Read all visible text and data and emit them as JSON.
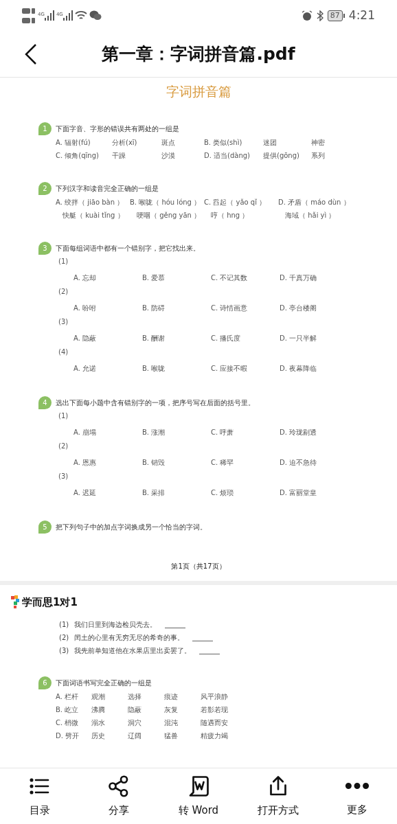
{
  "status_bar": {
    "network_1": "4G",
    "network_2": "4G",
    "battery": "87",
    "time": "4:21"
  },
  "title_bar": {
    "title": "第一章：字词拼音篇.pdf"
  },
  "page_1": {
    "heading": "字词拼音篇",
    "questions": [
      {
        "number": "1",
        "text": "下面字音、字形的错误共有两处的一组是",
        "kind": "grid",
        "rows": [
          [
            "A. 辐射(fú)",
            "分析(xī)",
            "斑点",
            "B. 类似(shì)",
            "迷团",
            "神密"
          ],
          [
            "C. 倾角(qīng)",
            "干躁",
            "沙漠",
            "D. 适当(dàng)",
            "提供(gōng)",
            "系列"
          ]
        ]
      },
      {
        "number": "2",
        "text": "下列汉字和读音完全正确的一组是",
        "kind": "grid",
        "rows": [
          [
            "A. 绞拌（ jiāo bàn ）",
            "B. 喉咙（ hóu lóng ）",
            "C. 舀起（ yǎo qǐ ）",
            "D. 矛盾（ máo dùn ）"
          ],
          [
            "　快艇（ kuài tǐng ）",
            "　哽咽（ gěng yān ）",
            "　哼（ hng ）",
            "　海域（ hǎi yì ）"
          ]
        ]
      },
      {
        "number": "3",
        "text": "下面每组词语中都有一个错别字，把它找出来。",
        "kind": "sub",
        "parts": [
          {
            "label": "(1)",
            "options": [
              "A. 忘却",
              "B. 爱慕",
              "C. 不记其数",
              "D. 千真万确"
            ]
          },
          {
            "label": "(2)",
            "options": [
              "A. 吩咐",
              "B. 防碍",
              "C. 诗情画意",
              "D. 亭台楼阁"
            ]
          },
          {
            "label": "(3)",
            "options": [
              "A. 隐蔽",
              "B. 酬谢",
              "C. 播氏度",
              "D. 一只半解"
            ]
          },
          {
            "label": "(4)",
            "options": [
              "A. 允诺",
              "B. 喉咙",
              "C. 应接不暇",
              "D. 夜幕降临"
            ]
          }
        ]
      },
      {
        "number": "4",
        "text": "选出下面每小题中含有错别字的一项，把序号写在后面的括号里。",
        "kind": "sub",
        "parts": [
          {
            "label": "(1)",
            "options": [
              "A. 崩塌",
              "B. 涨潮",
              "C. 呼萧",
              "D. 玲珑剔透"
            ]
          },
          {
            "label": "(2)",
            "options": [
              "A. 恩惠",
              "B. 销毁",
              "C. 稀罕",
              "D. 迫不急待"
            ]
          },
          {
            "label": "(3)",
            "options": [
              "A. 迟延",
              "B. 采排",
              "C. 烦琐",
              "D. 富丽堂皇"
            ]
          }
        ]
      },
      {
        "number": "5",
        "text": "把下列句子中的加点字词换成另一个恰当的字词。",
        "kind": "plain"
      }
    ],
    "footer": "第1页（共17页）"
  },
  "page_2": {
    "logo": "学而思1对1",
    "sentences": [
      {
        "label": "(1)",
        "text": "我们日里到海边检贝壳去。"
      },
      {
        "label": "(2)",
        "text": "闰土的心里有无穷无尽的希奇的事。"
      },
      {
        "label": "(3)",
        "text": "我先前单知道他在水果店里出卖罢了。"
      }
    ],
    "questions": [
      {
        "number": "6",
        "text": "下面词语书写完全正确的一组是",
        "kind": "grid",
        "rows": [
          [
            "A. 栏杆",
            "观潮",
            "选择",
            "痕迹",
            "风平浪静"
          ],
          [
            "B. 屹立",
            "沸腾",
            "隐蔽",
            "灰复",
            "若影若现"
          ],
          [
            "C. 梢微",
            "溺水",
            "洞穴",
            "混沌",
            "随遇而安"
          ],
          [
            "D. 劈开",
            "历史",
            "辽阔",
            "猛兽",
            "精疲力竭"
          ]
        ]
      }
    ]
  },
  "toolbar": [
    {
      "kind": "list",
      "label": "目录"
    },
    {
      "kind": "share",
      "label": "分享"
    },
    {
      "kind": "word",
      "label": "转 Word"
    },
    {
      "kind": "open",
      "label": "打开方式"
    },
    {
      "kind": "more",
      "label": "更多"
    }
  ]
}
